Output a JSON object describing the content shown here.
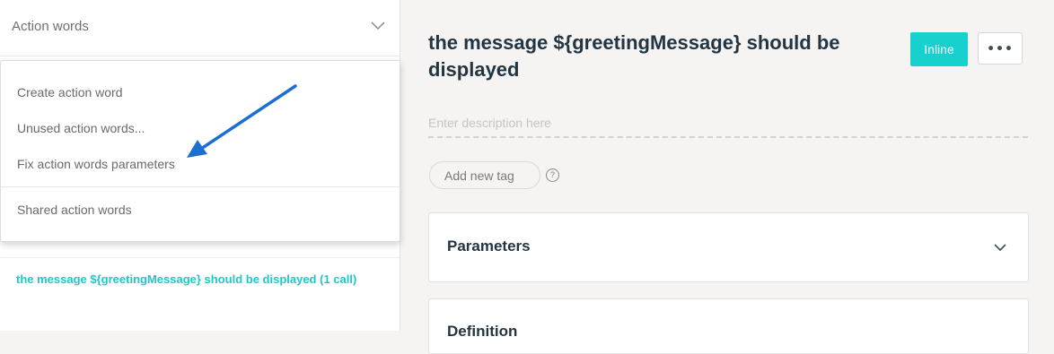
{
  "sidebar": {
    "header_title": "Action words",
    "hidden_row_text": "...greetingMessage... should be displayed",
    "called_item": "the message ${greetingMessage} should be displayed (1 call)"
  },
  "dropdown": {
    "items": [
      "Create action word",
      "Unused action words...",
      "Fix action words parameters",
      "Shared action words"
    ]
  },
  "detail": {
    "title": "the message ${greetingMessage} should be displayed",
    "inline_button": "Inline",
    "more_button": "•••",
    "description_placeholder": "Enter description here",
    "add_tag": "Add new tag",
    "help_glyph": "?",
    "sections": [
      "Parameters",
      "Definition"
    ]
  },
  "colors": {
    "accent": "#17d1cf",
    "link": "#1ec8c8",
    "arrow": "#1a6fd1"
  },
  "icons": [
    "chevron-down-icon",
    "more-icon",
    "help-icon",
    "annotation-arrow"
  ]
}
